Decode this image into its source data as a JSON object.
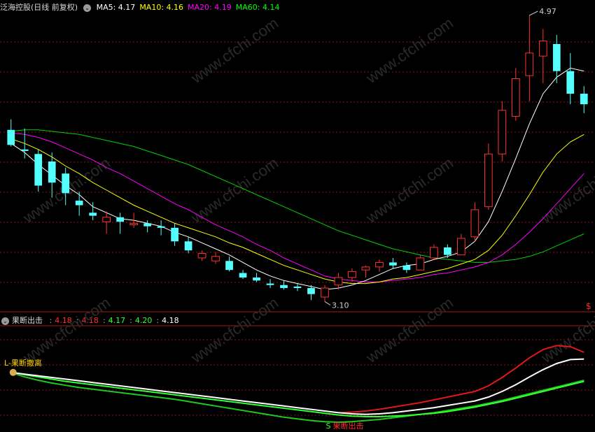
{
  "main_panel": {
    "title": "泛海控股(日线 前复权)",
    "ma_labels": [
      {
        "label": "MA5:",
        "value": "4.17",
        "color": "#ffffff"
      },
      {
        "label": "MA10:",
        "value": "4.16",
        "color": "#ffff00"
      },
      {
        "label": "MA20:",
        "value": "4.19",
        "color": "#ff00ff"
      },
      {
        "label": "MA60:",
        "value": "4.14",
        "color": "#00ff00"
      }
    ],
    "high_marker": "4.97",
    "low_marker": "3.10",
    "corner_mark": "$",
    "watermark": "www.cfchi.com"
  },
  "indicator_panel": {
    "title": "果断出击",
    "values": [
      {
        "value": "4.18",
        "color": "#ff3030"
      },
      {
        "value": "4.18",
        "color": "#ff3030"
      },
      {
        "value": "4.17",
        "color": "#33ff33"
      },
      {
        "value": "4.20",
        "color": "#33ff33"
      },
      {
        "value": "4.18",
        "color": "#ffffff"
      }
    ],
    "sell_signal": "果断撤离",
    "buy_signal": "果断出击",
    "sell_icon": "money-bag-icon",
    "buy_icon": "dollar-s-icon"
  },
  "colors": {
    "up": "#ff3232",
    "down": "#54ffff",
    "grid": "#8c1414",
    "ma5": "#ffffff",
    "ma10": "#ffff00",
    "ma20": "#ff00ff",
    "ma60": "#00d200"
  },
  "chart_data": {
    "type": "candlestick",
    "y_range": [
      3.1,
      4.97
    ],
    "candles": [
      {
        "o": 4.21,
        "h": 4.28,
        "l": 4.1,
        "c": 4.11
      },
      {
        "o": 4.08,
        "h": 4.22,
        "l": 4.02,
        "c": 4.07
      },
      {
        "o": 4.05,
        "h": 4.08,
        "l": 3.8,
        "c": 3.84
      },
      {
        "o": 4.0,
        "h": 4.06,
        "l": 3.76,
        "c": 3.86
      },
      {
        "o": 3.92,
        "h": 3.96,
        "l": 3.71,
        "c": 3.79
      },
      {
        "o": 3.74,
        "h": 3.8,
        "l": 3.64,
        "c": 3.71
      },
      {
        "o": 3.66,
        "h": 3.73,
        "l": 3.61,
        "c": 3.64
      },
      {
        "o": 3.6,
        "h": 3.67,
        "l": 3.52,
        "c": 3.63
      },
      {
        "o": 3.63,
        "h": 3.66,
        "l": 3.52,
        "c": 3.6
      },
      {
        "o": 3.58,
        "h": 3.66,
        "l": 3.56,
        "c": 3.59
      },
      {
        "o": 3.59,
        "h": 3.61,
        "l": 3.53,
        "c": 3.57
      },
      {
        "o": 3.57,
        "h": 3.61,
        "l": 3.51,
        "c": 3.56
      },
      {
        "o": 3.56,
        "h": 3.59,
        "l": 3.44,
        "c": 3.47
      },
      {
        "o": 3.47,
        "h": 3.5,
        "l": 3.39,
        "c": 3.41
      },
      {
        "o": 3.36,
        "h": 3.41,
        "l": 3.34,
        "c": 3.39
      },
      {
        "o": 3.34,
        "h": 3.4,
        "l": 3.32,
        "c": 3.37
      },
      {
        "o": 3.34,
        "h": 3.37,
        "l": 3.27,
        "c": 3.28
      },
      {
        "o": 3.26,
        "h": 3.28,
        "l": 3.22,
        "c": 3.23
      },
      {
        "o": 3.23,
        "h": 3.26,
        "l": 3.2,
        "c": 3.21
      },
      {
        "o": 3.19,
        "h": 3.22,
        "l": 3.16,
        "c": 3.18
      },
      {
        "o": 3.18,
        "h": 3.21,
        "l": 3.15,
        "c": 3.16
      },
      {
        "o": 3.17,
        "h": 3.19,
        "l": 3.14,
        "c": 3.16
      },
      {
        "o": 3.16,
        "h": 3.18,
        "l": 3.08,
        "c": 3.12
      },
      {
        "o": 3.1,
        "h": 3.18,
        "l": 3.07,
        "c": 3.16
      },
      {
        "o": 3.18,
        "h": 3.26,
        "l": 3.15,
        "c": 3.23
      },
      {
        "o": 3.23,
        "h": 3.29,
        "l": 3.2,
        "c": 3.27
      },
      {
        "o": 3.28,
        "h": 3.31,
        "l": 3.23,
        "c": 3.3
      },
      {
        "o": 3.3,
        "h": 3.35,
        "l": 3.27,
        "c": 3.33
      },
      {
        "o": 3.33,
        "h": 3.36,
        "l": 3.29,
        "c": 3.31
      },
      {
        "o": 3.31,
        "h": 3.33,
        "l": 3.26,
        "c": 3.28
      },
      {
        "o": 3.28,
        "h": 3.38,
        "l": 3.28,
        "c": 3.36
      },
      {
        "o": 3.36,
        "h": 3.45,
        "l": 3.35,
        "c": 3.43
      },
      {
        "o": 3.43,
        "h": 3.45,
        "l": 3.36,
        "c": 3.38
      },
      {
        "o": 3.38,
        "h": 3.52,
        "l": 3.38,
        "c": 3.49
      },
      {
        "o": 3.5,
        "h": 3.73,
        "l": 3.47,
        "c": 3.68
      },
      {
        "o": 3.7,
        "h": 4.12,
        "l": 3.68,
        "c": 4.05
      },
      {
        "o": 4.05,
        "h": 4.4,
        "l": 4.0,
        "c": 4.34
      },
      {
        "o": 4.3,
        "h": 4.62,
        "l": 4.27,
        "c": 4.55
      },
      {
        "o": 4.57,
        "h": 4.97,
        "l": 4.4,
        "c": 4.72
      },
      {
        "o": 4.7,
        "h": 4.88,
        "l": 4.52,
        "c": 4.8
      },
      {
        "o": 4.78,
        "h": 4.84,
        "l": 4.52,
        "c": 4.6
      },
      {
        "o": 4.6,
        "h": 4.72,
        "l": 4.38,
        "c": 4.45
      },
      {
        "o": 4.45,
        "h": 4.5,
        "l": 4.32,
        "c": 4.38
      }
    ],
    "ma5": [
      4.12,
      4.06,
      3.98,
      3.91,
      3.84,
      3.78,
      3.7,
      3.66,
      3.62,
      3.61,
      3.59,
      3.57,
      3.53,
      3.5,
      3.46,
      3.42,
      3.38,
      3.33,
      3.28,
      3.24,
      3.21,
      3.19,
      3.17,
      3.15,
      3.16,
      3.18,
      3.21,
      3.25,
      3.29,
      3.31,
      3.32,
      3.35,
      3.37,
      3.4,
      3.47,
      3.6,
      3.8,
      4.02,
      4.25,
      4.45,
      4.56,
      4.62,
      4.6
    ],
    "ma10": [
      4.15,
      4.12,
      4.08,
      4.03,
      3.97,
      3.92,
      3.86,
      3.81,
      3.76,
      3.71,
      3.67,
      3.63,
      3.59,
      3.56,
      3.53,
      3.5,
      3.46,
      3.43,
      3.39,
      3.35,
      3.31,
      3.28,
      3.25,
      3.22,
      3.2,
      3.19,
      3.19,
      3.2,
      3.22,
      3.23,
      3.25,
      3.27,
      3.29,
      3.32,
      3.35,
      3.41,
      3.51,
      3.64,
      3.78,
      3.93,
      4.05,
      4.13,
      4.18
    ],
    "ma20": [
      4.19,
      4.18,
      4.16,
      4.13,
      4.09,
      4.05,
      4.01,
      3.96,
      3.92,
      3.87,
      3.82,
      3.77,
      3.72,
      3.68,
      3.63,
      3.58,
      3.54,
      3.5,
      3.45,
      3.41,
      3.36,
      3.32,
      3.28,
      3.24,
      3.22,
      3.21,
      3.2,
      3.2,
      3.21,
      3.22,
      3.23,
      3.25,
      3.26,
      3.28,
      3.3,
      3.33,
      3.38,
      3.45,
      3.53,
      3.62,
      3.72,
      3.82,
      3.92
    ],
    "ma60": [
      4.2,
      4.21,
      4.21,
      4.2,
      4.19,
      4.18,
      4.16,
      4.14,
      4.12,
      4.1,
      4.07,
      4.04,
      4.01,
      3.98,
      3.94,
      3.9,
      3.86,
      3.82,
      3.78,
      3.74,
      3.7,
      3.66,
      3.62,
      3.58,
      3.54,
      3.51,
      3.48,
      3.45,
      3.42,
      3.4,
      3.38,
      3.36,
      3.35,
      3.34,
      3.33,
      3.33,
      3.34,
      3.35,
      3.37,
      3.4,
      3.44,
      3.48,
      3.52
    ],
    "indicator": {
      "green": [
        3.95,
        3.9,
        3.86,
        3.82,
        3.78,
        3.75,
        3.72,
        3.69,
        3.66,
        3.63,
        3.6,
        3.57,
        3.54,
        3.51,
        3.48,
        3.45,
        3.42,
        3.39,
        3.36,
        3.33,
        3.3,
        3.27,
        3.24,
        3.21,
        3.18,
        3.16,
        3.15,
        3.15,
        3.16,
        3.17,
        3.19,
        3.21,
        3.24,
        3.28,
        3.32,
        3.37,
        3.42,
        3.48,
        3.54,
        3.6,
        3.66,
        3.72,
        3.78
      ],
      "dark_green": [
        3.94,
        3.86,
        3.8,
        3.75,
        3.71,
        3.67,
        3.64,
        3.61,
        3.58,
        3.55,
        3.52,
        3.49,
        3.46,
        3.42,
        3.38,
        3.34,
        3.3,
        3.26,
        3.22,
        3.18,
        3.14,
        3.11,
        3.08,
        3.06,
        3.05,
        3.06,
        3.08,
        3.1,
        3.13,
        3.16,
        3.19,
        3.22,
        3.26,
        3.3,
        3.34,
        3.39,
        3.44,
        3.5,
        3.56,
        3.62,
        3.68,
        3.74,
        3.8
      ],
      "white": [
        3.94,
        3.91,
        3.88,
        3.85,
        3.82,
        3.79,
        3.76,
        3.73,
        3.7,
        3.67,
        3.64,
        3.61,
        3.58,
        3.55,
        3.52,
        3.49,
        3.46,
        3.43,
        3.4,
        3.37,
        3.34,
        3.31,
        3.28,
        3.25,
        3.22,
        3.2,
        3.19,
        3.2,
        3.22,
        3.25,
        3.28,
        3.31,
        3.35,
        3.39,
        3.43,
        3.5,
        3.6,
        3.72,
        3.86,
        3.99,
        4.1,
        4.17,
        4.18
      ],
      "red": [
        null,
        null,
        null,
        null,
        null,
        null,
        null,
        null,
        null,
        null,
        null,
        null,
        null,
        null,
        null,
        null,
        null,
        null,
        null,
        null,
        null,
        null,
        null,
        null,
        3.22,
        3.23,
        3.25,
        3.28,
        3.32,
        3.36,
        3.4,
        3.45,
        3.5,
        3.55,
        3.6,
        3.7,
        3.85,
        4.02,
        4.2,
        4.35,
        4.42,
        4.4,
        4.3
      ],
      "y_range": [
        3.0,
        4.5
      ]
    }
  }
}
